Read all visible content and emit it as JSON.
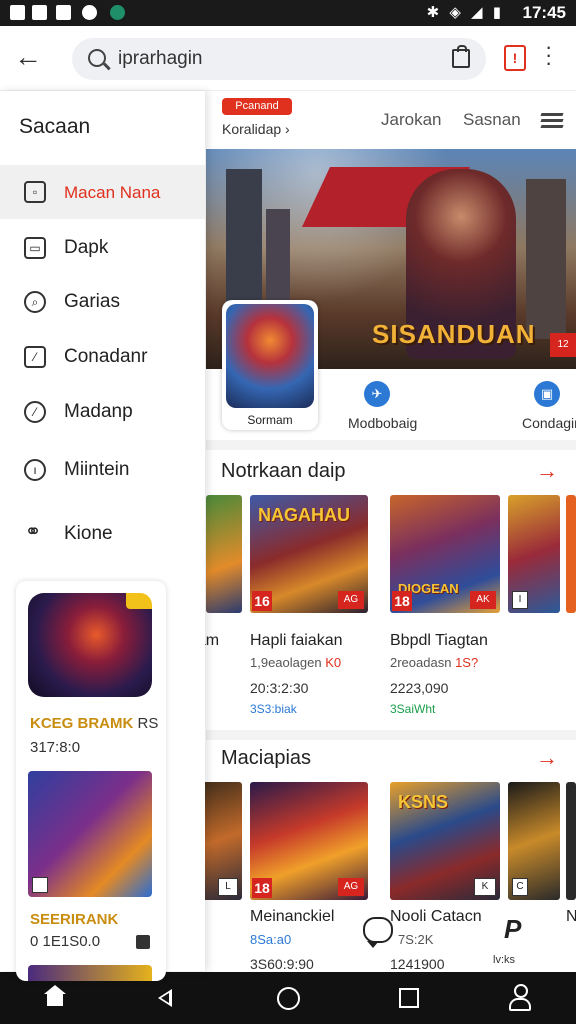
{
  "status_bar": {
    "time": "17:45"
  },
  "top_bar": {
    "search_value": "iprarhagin"
  },
  "drawer": {
    "title": "Sacaan",
    "items": [
      {
        "label": "Macan Nana",
        "icon": "bag-icon",
        "active": true
      },
      {
        "label": "Dapk",
        "icon": "document-icon",
        "active": false
      },
      {
        "label": "Garias",
        "icon": "tag-icon",
        "active": false
      },
      {
        "label": "Conadanr",
        "icon": "edit-icon",
        "active": false
      },
      {
        "label": "Madanp",
        "icon": "compass-icon",
        "active": false
      },
      {
        "label": "Miintein",
        "icon": "info-icon",
        "active": false
      },
      {
        "label": "Kione",
        "icon": "people-icon",
        "active": false
      }
    ],
    "promo": {
      "first": {
        "title": "KCEG BRAMK",
        "tag": "RS",
        "number": "317:8:0"
      },
      "second": {
        "title": "SEERIRANK",
        "number": "0 1E1S0.0"
      }
    }
  },
  "main": {
    "badge": "Pcanand",
    "sublink": "Koralidap",
    "tabs": [
      "Jarokan",
      "Sasnan"
    ],
    "hero": {
      "title": "SISANDUAN",
      "icon_label": "Sormam"
    },
    "quick_links": [
      {
        "label": "Modbobaig",
        "icon": "plane-icon"
      },
      {
        "label": "Condagin",
        "icon": "monitor-icon"
      }
    ],
    "sections": [
      {
        "title": "Notrkaan daip",
        "partial_label": "nam",
        "cards": [
          {
            "title": "Hapli faiakan",
            "sub": "1,9eaolagen",
            "sub_red": "K0",
            "price": "20:3:2:30",
            "badge": "3S3:biak",
            "badge_color": "blue",
            "watermark": "NAGAHAU"
          },
          {
            "title": "Bbpdl Tiagtan",
            "sub": "2reoadasn",
            "sub_red": "1S?",
            "price": "2223,090",
            "badge": "3SaiWht",
            "badge_color": "green",
            "watermark": "DIOGEAN"
          }
        ]
      },
      {
        "title": "Maciapias",
        "partial_label": "n",
        "cards": [
          {
            "title": "Meinanckiel",
            "sub": "8Sa:a0",
            "price": "3S60:9:90",
            "watermark": ""
          },
          {
            "title": "Nooli Catacn",
            "sub": "7S:2K",
            "price": "1241900",
            "watermark": "KSNS"
          }
        ],
        "extra_label": "N"
      }
    ],
    "floating": {
      "chat_caption": "",
      "p_caption": "lv:ks"
    }
  },
  "colors": {
    "accent": "#e0301e",
    "link_blue": "#2b79d4",
    "badge_green": "#1a9e49"
  }
}
